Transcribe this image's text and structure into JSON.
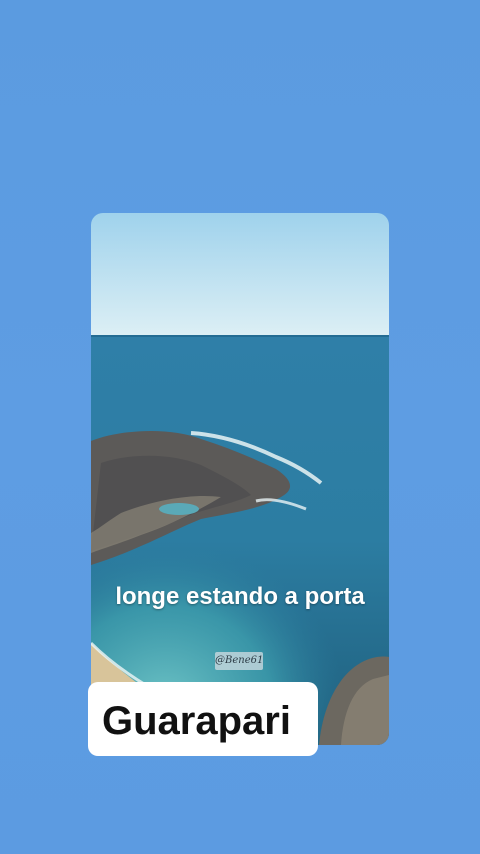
{
  "story": {
    "caption": "longe estando a porta",
    "watermark": "@Bene61",
    "location_label": "Guarapari"
  },
  "colors": {
    "background": "#5c9be1",
    "label_background": "#ffffff",
    "label_text": "#111111",
    "caption_text": "#ffffff"
  }
}
